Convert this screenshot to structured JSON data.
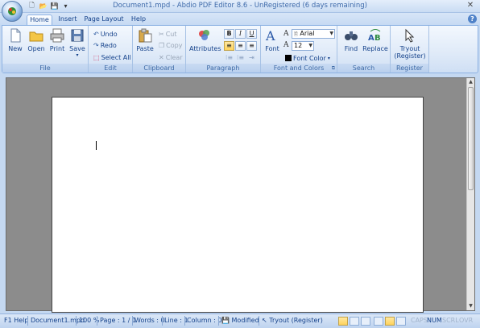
{
  "window": {
    "title": "Document1.mpd - Abdio PDF Editor 8.6 - UnRegistered (6 days remaining)",
    "close_glyph": "✕"
  },
  "tabs": [
    {
      "label": "Home",
      "active": true
    },
    {
      "label": "Insert",
      "active": false
    },
    {
      "label": "Page Layout",
      "active": false
    },
    {
      "label": "Help",
      "active": false
    }
  ],
  "ribbon": {
    "file": {
      "label": "File",
      "new": "New",
      "open": "Open",
      "print": "Print",
      "save": "Save"
    },
    "edit": {
      "label": "Edit",
      "undo": "Undo",
      "redo": "Redo",
      "select_all": "Select All"
    },
    "clipboard": {
      "label": "Clipboard",
      "paste": "Paste",
      "cut": "Cut",
      "copy": "Copy",
      "clear": "Clear"
    },
    "paragraph": {
      "label": "Paragraph",
      "attributes": "Attributes",
      "bold": "B",
      "italic": "I",
      "underline": "U"
    },
    "font": {
      "label": "Font and Colors",
      "font_button": "Font",
      "font_name": "Arial",
      "font_size": "12",
      "font_color": "Font Color"
    },
    "search": {
      "label": "Search",
      "find": "Find",
      "replace": "Replace"
    },
    "register": {
      "label": "Register",
      "tryout_line1": "Tryout",
      "tryout_line2": "(Register)"
    }
  },
  "status": {
    "help": "F1 Help",
    "file": "Document1.mpd",
    "zoom": "100 %",
    "page": "Page : 1 / 1",
    "words": "Words : 0",
    "line": "Line : 1",
    "column": "Column : 0",
    "modified": "Modified",
    "tryout": "Tryout (Register)",
    "caps": "CAPS",
    "num": "NUM",
    "scrl": "SCRL",
    "ovr": "OVR"
  },
  "colors": {
    "accent": "#15428b",
    "ribbon_bg": "#dfeaf8",
    "workspace": "#8c8c8c",
    "active_toggle": "#ffd35b"
  }
}
